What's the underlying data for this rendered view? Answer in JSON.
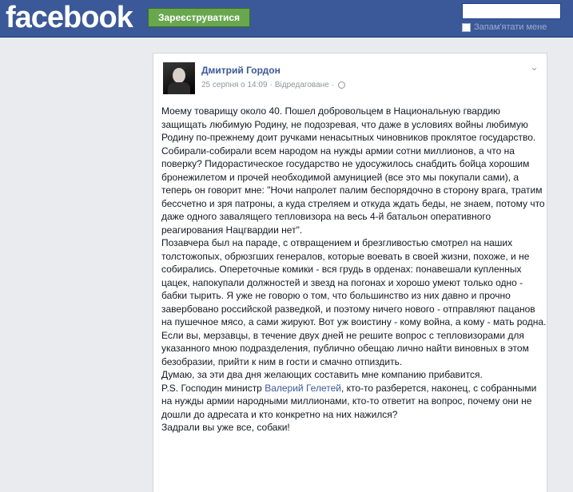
{
  "header": {
    "logo": "facebook",
    "register_label": "Зареєструватися",
    "email_value": "",
    "remember_label": "Запам'ятати мене"
  },
  "post": {
    "author": "Дмитрий Гордон",
    "date": "25 серпня о 14:09",
    "sep1": "·",
    "edited": "Відредаговане",
    "sep2": "·",
    "p1": "Моему товарищу около 40. Пошел добровольцем в Национальную гвардию защищать любимую Родину, не подозревая, что даже в условиях войны любимую Родину по-прежнему доит ручками ненасытных чиновников проклятое государство. Собирали-собирали всем народом на нужды армии сотни миллионов, а что на поверку? Пидорастическое государство не удосужилось снабдить бойца хорошим бронежилетом и прочей необходимой амуницией (все это мы покупали сами), а теперь он говорит мне: \"Ночи напролет палим беспорядочно в сторону врага, тратим бессчетно и зря патроны, а куда стреляем и откуда ждать беды, не знаем, потому что даже одного завалящего тепловизора на весь 4-й батальон оперативного реагирования Нацгвардии нет\".",
    "p2": "Позавчера был на параде, с отвращением и брезгливостью смотрел на наших толстожопых, обрюзгших генералов, которые воевать в своей жизни, похоже, и не собирались. Опереточные комики - вся грудь в орденах: понавешали купленных цацек, напокупали должностей и звезд на погонах и хорошо умеют только одно - бабки тырить. Я уже не говорю о том, что большинство из них давно и прочно завербовано российской разведкой, и поэтому ничего нового - отправляют пацанов на пушечное мясо, а сами жируют. Вот уж воистину - кому война, а кому - мать родна.",
    "p3": "Если вы, мерзавцы, в течение двух дней не решите вопрос с тепловизорами для указанного мною подразделения, публично обещаю лично найти виновных в этом безобразии, прийти к ним в гости и смачно отпиздить.",
    "p4": "Думаю, за эти два дня желающих составить мне компанию прибавится.",
    "p5_before": "P.S. Господин министр ",
    "p5_link": "Валерий Гелетей",
    "p5_after": ", кто-то разберется, наконец, с собранными на нужды армии народными миллионами, кто-то ответит на вопрос, почему они не дошли до адресата и кто конкретно на них нажился?",
    "p6": "Задрали вы уже все, собаки!"
  },
  "icons": {
    "globe": "globe-icon",
    "chevron": "chevron-down-icon",
    "avatar": "avatar"
  }
}
